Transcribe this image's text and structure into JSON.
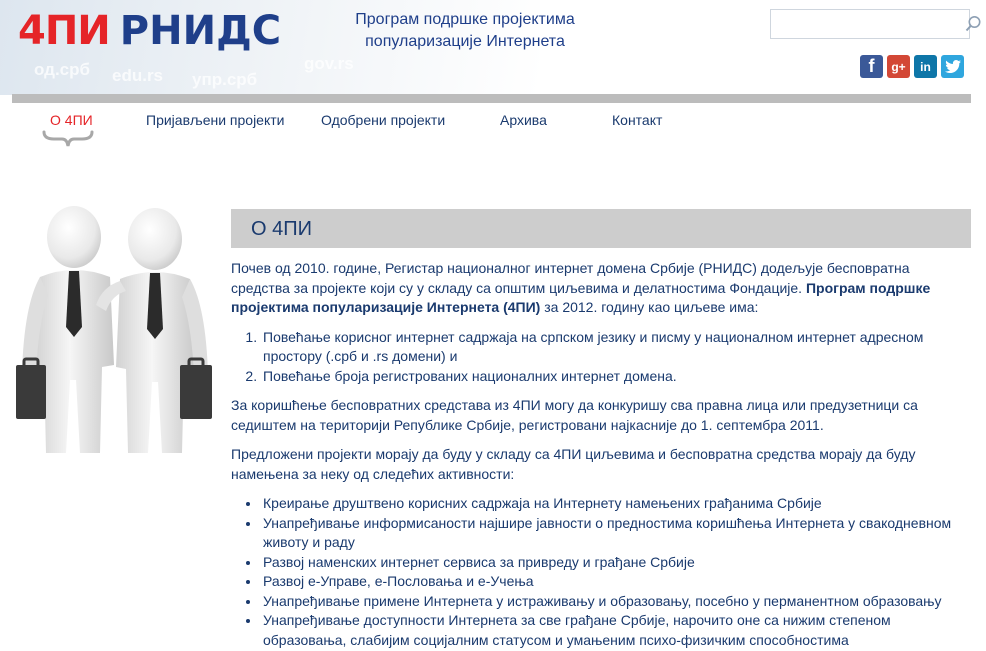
{
  "header": {
    "logo_4pi": "4ПИ",
    "logo_rnids": "РНИДС",
    "tagline_line1": "Програм подршке пројектима",
    "tagline_line2": "популаризације Интернета",
    "ghost_texts": [
      "од.срб",
      "edu.rs",
      "упр.срб",
      "gov.rs"
    ],
    "search": {
      "value": "",
      "placeholder": ""
    },
    "social": [
      "facebook-icon",
      "google-plus-icon",
      "linkedin-icon",
      "twitter-icon"
    ]
  },
  "nav": {
    "items": [
      {
        "label": "О 4ПИ",
        "active": true
      },
      {
        "label": "Пријављени пројекти",
        "active": false
      },
      {
        "label": "Одобрени пројекти",
        "active": false
      },
      {
        "label": "Архива",
        "active": false
      },
      {
        "label": "Контакт",
        "active": false
      }
    ]
  },
  "section": {
    "title": "О 4ПИ"
  },
  "content": {
    "p1_start": "Почев од 2010. године, Регистар националног интернет домена Србије (РНИДС) додељује бесповратна средства за пројекте који су у складу са општим циљевима и делатностима Фондације. ",
    "p1_bold": "Програм подршке пројектима популаризације Интернета (4ПИ)",
    "p1_end": " за 2012. годину као циљеве има:",
    "goals": [
      "Повећање корисног интернет садржаја на српском језику и писму у националном интернет адресном простору (.срб и .rs домени) и",
      "Повећање броја регистрованих националних интернет домена."
    ],
    "p2": "За коришћење бесповратних средстава из 4ПИ могу да конкуришу сва правна лица или предузетници са седиштем на територији Републике Србије, регистровани најкасније до 1. септембра 2011.",
    "p3": "Предложени пројекти морају да буду у складу са 4ПИ циљевима и бесповратна средства морају да буду намењена за неку од следећих активности:",
    "activities": [
      "Креирање друштвено корисних садржаја на Интернету намењених грађанима Србије",
      "Унапређивање информисаности најшире јавности о предностима коришћења Интернета у свакодневном животу и раду",
      "Развој наменских интернет сервиса за привреду и грађане Србије",
      "Развој е-Управе, е-Пословања и е-Учења",
      "Унапређивање примене Интернета у истраживању и образовању, посебно у перманентном образовању",
      "Унапређивање доступности Интернета за све грађане Србије, нарочито оне са нижим степеном образовања, слабијим социјалним статусом и умањеним психо-физичким способностима"
    ]
  }
}
